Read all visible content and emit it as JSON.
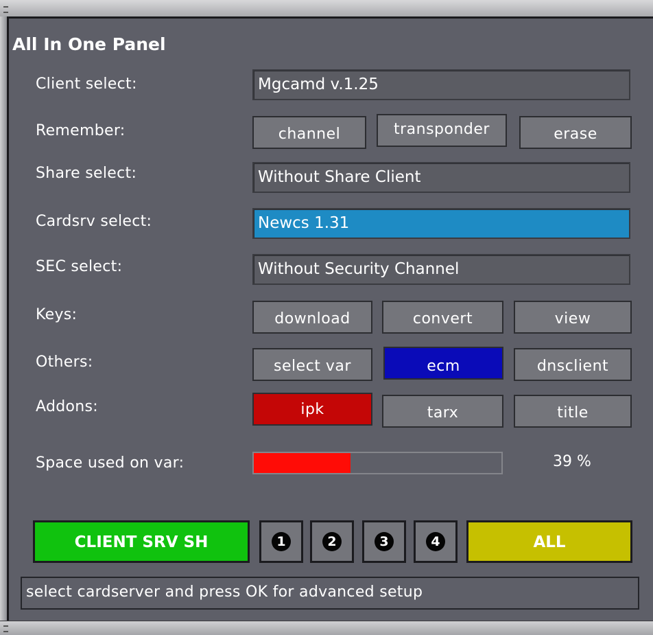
{
  "title": "All In One Panel",
  "rows": {
    "client": {
      "label": "Client select:",
      "value": "Mgcamd v.1.25"
    },
    "remember": {
      "label": "Remember:",
      "buttons": [
        "channel",
        "transponder",
        "erase"
      ]
    },
    "share": {
      "label": "Share select:",
      "value": "Without Share Client"
    },
    "cardsrv": {
      "label": "Cardsrv select:",
      "value": "Newcs 1.31"
    },
    "sec": {
      "label": "SEC select:",
      "value": "Without Security Channel"
    },
    "keys": {
      "label": "Keys:",
      "buttons": [
        "download",
        "convert",
        "view"
      ]
    },
    "others": {
      "label": "Others:",
      "buttons": [
        "select var",
        "ecm",
        "dnsclient"
      ]
    },
    "addons": {
      "label": "Addons:",
      "buttons": [
        "ipk",
        "tarx",
        "title"
      ]
    }
  },
  "space": {
    "label": "Space used on var:",
    "percent_text": "39 %",
    "fraction": 0.39
  },
  "bottom": {
    "client_srv_sh": "CLIENT SRV SH",
    "numbers": [
      "1",
      "2",
      "3",
      "4"
    ],
    "all": "ALL"
  },
  "status_text": "select cardserver and press OK for advanced setup",
  "colors": {
    "green": "#10c20e",
    "yellow": "#c6c000",
    "blue_button": "#0a0bb8",
    "red_button": "#c40606",
    "selected_field": "#1e8bc4",
    "bar_fill": "#ff0c06"
  }
}
